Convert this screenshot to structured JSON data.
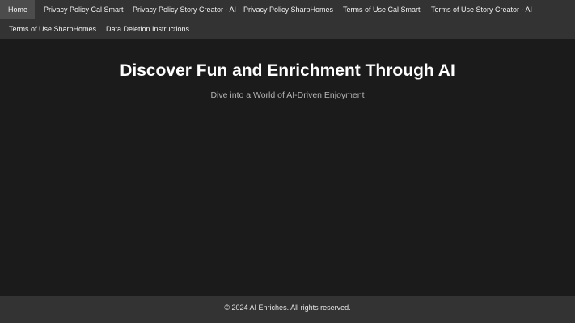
{
  "nav": {
    "items": [
      {
        "label": "Home",
        "active": true
      },
      {
        "label": "Privacy Policy Cal Smart",
        "active": false
      },
      {
        "label": "Privacy Policy Story Creator - AI",
        "active": false
      },
      {
        "label": "Privacy Policy SharpHomes",
        "active": false
      },
      {
        "label": "Terms of Use Cal Smart",
        "active": false
      },
      {
        "label": "Terms of Use Story Creator - AI",
        "active": false
      },
      {
        "label": "Terms of Use SharpHomes",
        "active": false
      },
      {
        "label": "Data Deletion Instructions",
        "active": false
      }
    ]
  },
  "hero": {
    "title": "Discover Fun and Enrichment Through AI",
    "subtitle": "Dive into a World of AI-Driven Enjoyment"
  },
  "footer": {
    "text": "© 2024 AI Enriches. All rights reserved."
  },
  "colors": {
    "background": "#1b1b1b",
    "navbar": "#333333",
    "nav_active": "#4c4c4c",
    "text_primary": "#ffffff",
    "text_secondary": "#b5b5b5"
  }
}
